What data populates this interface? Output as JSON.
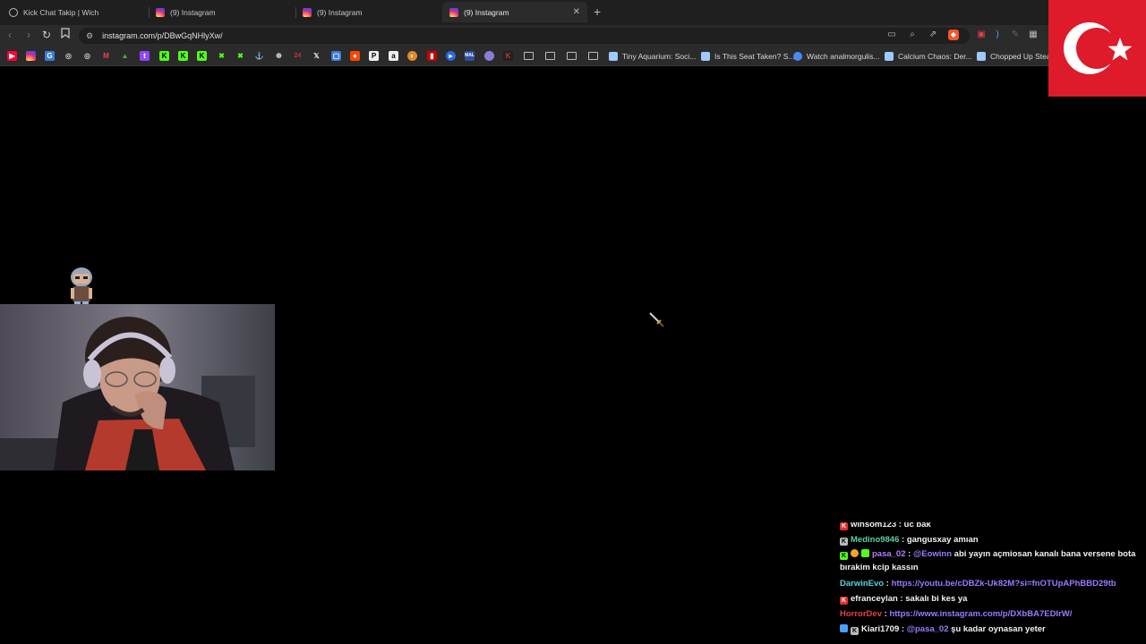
{
  "tabs": [
    {
      "label": "Kick Chat Takip | Wich",
      "icon": "globe-icon"
    },
    {
      "label": "(9) Instagram",
      "icon": "instagram-icon"
    },
    {
      "label": "(9) Instagram",
      "icon": "instagram-icon"
    },
    {
      "label": "(9) Instagram",
      "icon": "instagram-icon",
      "active": true
    }
  ],
  "address": {
    "url": "instagram.com/p/DBwGqNHlyXw/"
  },
  "bookmarks": {
    "named": [
      "Tiny Aquarium: Soci...",
      "Is This Seat Taken? S...",
      "Watch analmorgulis...",
      "Calcium Chaos: Der...",
      "Chopped Up Steam"
    ]
  },
  "chat": {
    "messages": [
      {
        "user": "winsom123",
        "text": ": üc bak",
        "user_color": "#f2f2f2"
      },
      {
        "user": "Medino9846",
        "text": ": gangusxay amıan",
        "user_color": "#5ad1a0"
      },
      {
        "user": "pasa_02",
        "mention": "@Eowinn",
        "text": " abi yayın açmiosan kanalı bana versene bota bırakim kcip kassın",
        "user_color": "#b57cff"
      },
      {
        "user": "DarwinEvo",
        "link": "https://youtu.be/cDBZk-Uk82M?si=fnOTUpAPhBBD29tb",
        "user_color": "#5ad1e0"
      },
      {
        "user": "efranceylan",
        "text": ": sakalı bi kes ya",
        "user_color": "#f2f2f2"
      },
      {
        "user": "HorrorDev",
        "link": "https://www.instagram.com/p/DXbBA7EDIrW/",
        "user_color": "#e0404a"
      },
      {
        "user": "Kiari1709",
        "mention": "@pasa_02",
        "text": " şu kadar oynasan yeter",
        "user_color": "#f2f2f2"
      }
    ]
  },
  "colors": {
    "accent_red": "#dd1b2a",
    "kick_green": "#53fc18",
    "link_purple": "#9b7cff"
  }
}
